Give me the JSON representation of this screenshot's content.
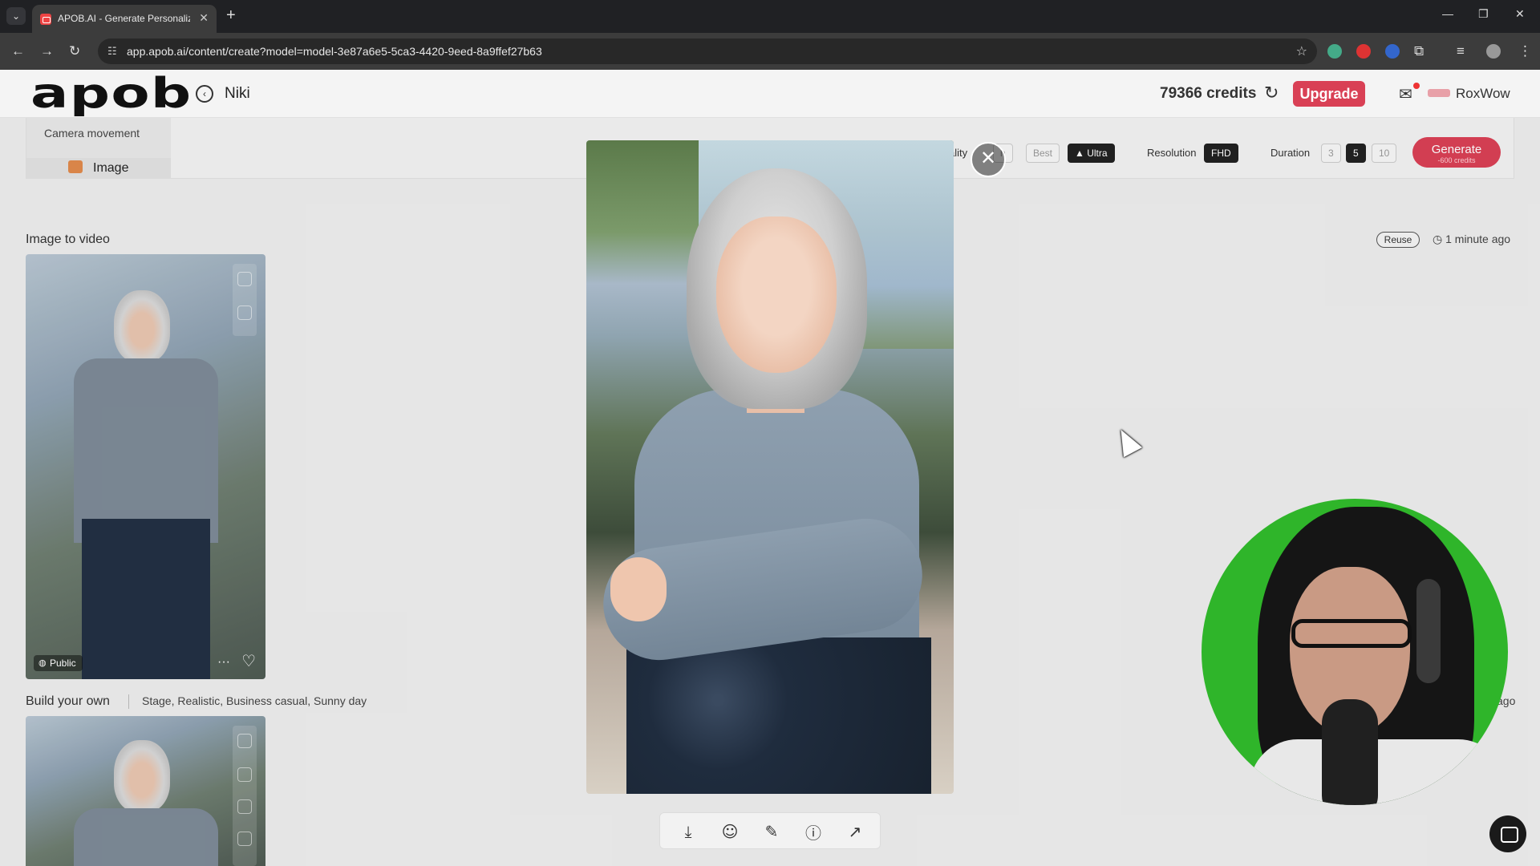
{
  "browser": {
    "tab_title": "APOB.AI - Generate Personalize",
    "url": "app.apob.ai/content/create?model=model-3e87a6e5-5ca3-4420-9eed-8a9ffef27b63"
  },
  "header": {
    "logo": "apob",
    "model_name": "Niki",
    "credits": "79366 credits",
    "upgrade_label": "Upgrade",
    "username": "RoxWow"
  },
  "settings": {
    "camera_movement": "Camera movement",
    "image_tab": "Image",
    "quality_label": "ality",
    "quality_partial": "h",
    "quality_options": [
      "Best",
      "Ultra"
    ],
    "resolution_label": "Resolution",
    "resolution_value": "FHD",
    "duration_label": "Duration",
    "duration_options": [
      "3",
      "5",
      "10"
    ],
    "generate_label": "Generate",
    "generate_cost": "-600 credits"
  },
  "history": [
    {
      "title": "Image to video",
      "reuse_label": "Reuse",
      "time": "1 minute ago",
      "badge": "Public"
    },
    {
      "title": "Build your own",
      "tags": "Stage, Realistic, Business casual, Sunny day",
      "time_partial": "ago"
    }
  ],
  "icons": {
    "close": "✕",
    "download": "⤓",
    "face": "☺",
    "magic": "✎",
    "info": "ⓘ",
    "share": "↗"
  },
  "colors": {
    "accent": "#d94055",
    "dark_chip": "#222222",
    "webcam_bg": "#2fb52a"
  }
}
